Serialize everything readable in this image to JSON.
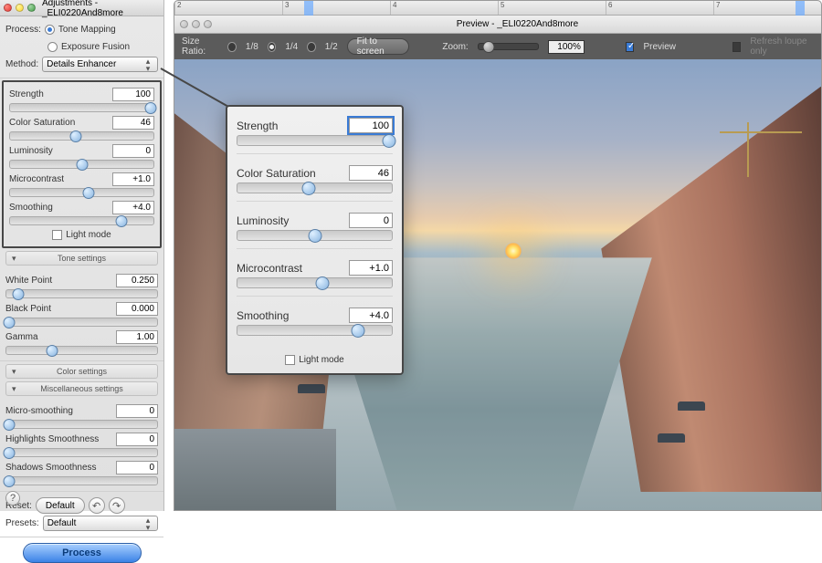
{
  "adjustments": {
    "title": "Adjustments - _ELI0220And8more",
    "process_label": "Process:",
    "process_opts": {
      "tone_mapping": "Tone Mapping",
      "exposure_fusion": "Exposure Fusion"
    },
    "method_label": "Method:",
    "method_value": "Details Enhancer",
    "sliders": [
      {
        "label": "Strength",
        "value": "100",
        "pos": 98
      },
      {
        "label": "Color Saturation",
        "value": "46",
        "pos": 46
      },
      {
        "label": "Luminosity",
        "value": "0",
        "pos": 50
      },
      {
        "label": "Microcontrast",
        "value": "+1.0",
        "pos": 55
      },
      {
        "label": "Smoothing",
        "value": "+4.0",
        "pos": 78
      }
    ],
    "light_mode": "Light mode",
    "tone_section": "Tone settings",
    "tone_sliders": [
      {
        "label": "White Point",
        "value": "0.250",
        "pos": 8
      },
      {
        "label": "Black Point",
        "value": "0.000",
        "pos": 2
      },
      {
        "label": "Gamma",
        "value": "1.00",
        "pos": 30
      }
    ],
    "color_section": "Color settings",
    "misc_section": "Miscellaneous settings",
    "misc_sliders": [
      {
        "label": "Micro-smoothing",
        "value": "0",
        "pos": 2
      },
      {
        "label": "Highlights Smoothness",
        "value": "0",
        "pos": 2
      },
      {
        "label": "Shadows Smoothness",
        "value": "0",
        "pos": 2
      }
    ],
    "reset_label": "Reset:",
    "default_btn": "Default",
    "presets_label": "Presets:",
    "presets_value": "Default",
    "process_btn": "Process"
  },
  "preview": {
    "title": "Preview - _ELI0220And8more",
    "size_ratio_label": "Size Ratio:",
    "ratios": [
      "1/8",
      "1/4",
      "1/2"
    ],
    "fit_btn": "Fit to screen",
    "zoom_label": "Zoom:",
    "zoom_value": "100%",
    "preview_check": "Preview",
    "refresh_loupe": "Refresh loupe only",
    "ruler_marks": [
      "2",
      "3",
      "4",
      "5",
      "6",
      "7"
    ]
  },
  "callout": {
    "sliders": [
      {
        "label": "Strength",
        "value": "100",
        "pos": 98,
        "focused": true
      },
      {
        "label": "Color Saturation",
        "value": "46",
        "pos": 46
      },
      {
        "label": "Luminosity",
        "value": "0",
        "pos": 50
      },
      {
        "label": "Microcontrast",
        "value": "+1.0",
        "pos": 55
      },
      {
        "label": "Smoothing",
        "value": "+4.0",
        "pos": 78
      }
    ],
    "light_mode": "Light mode"
  }
}
